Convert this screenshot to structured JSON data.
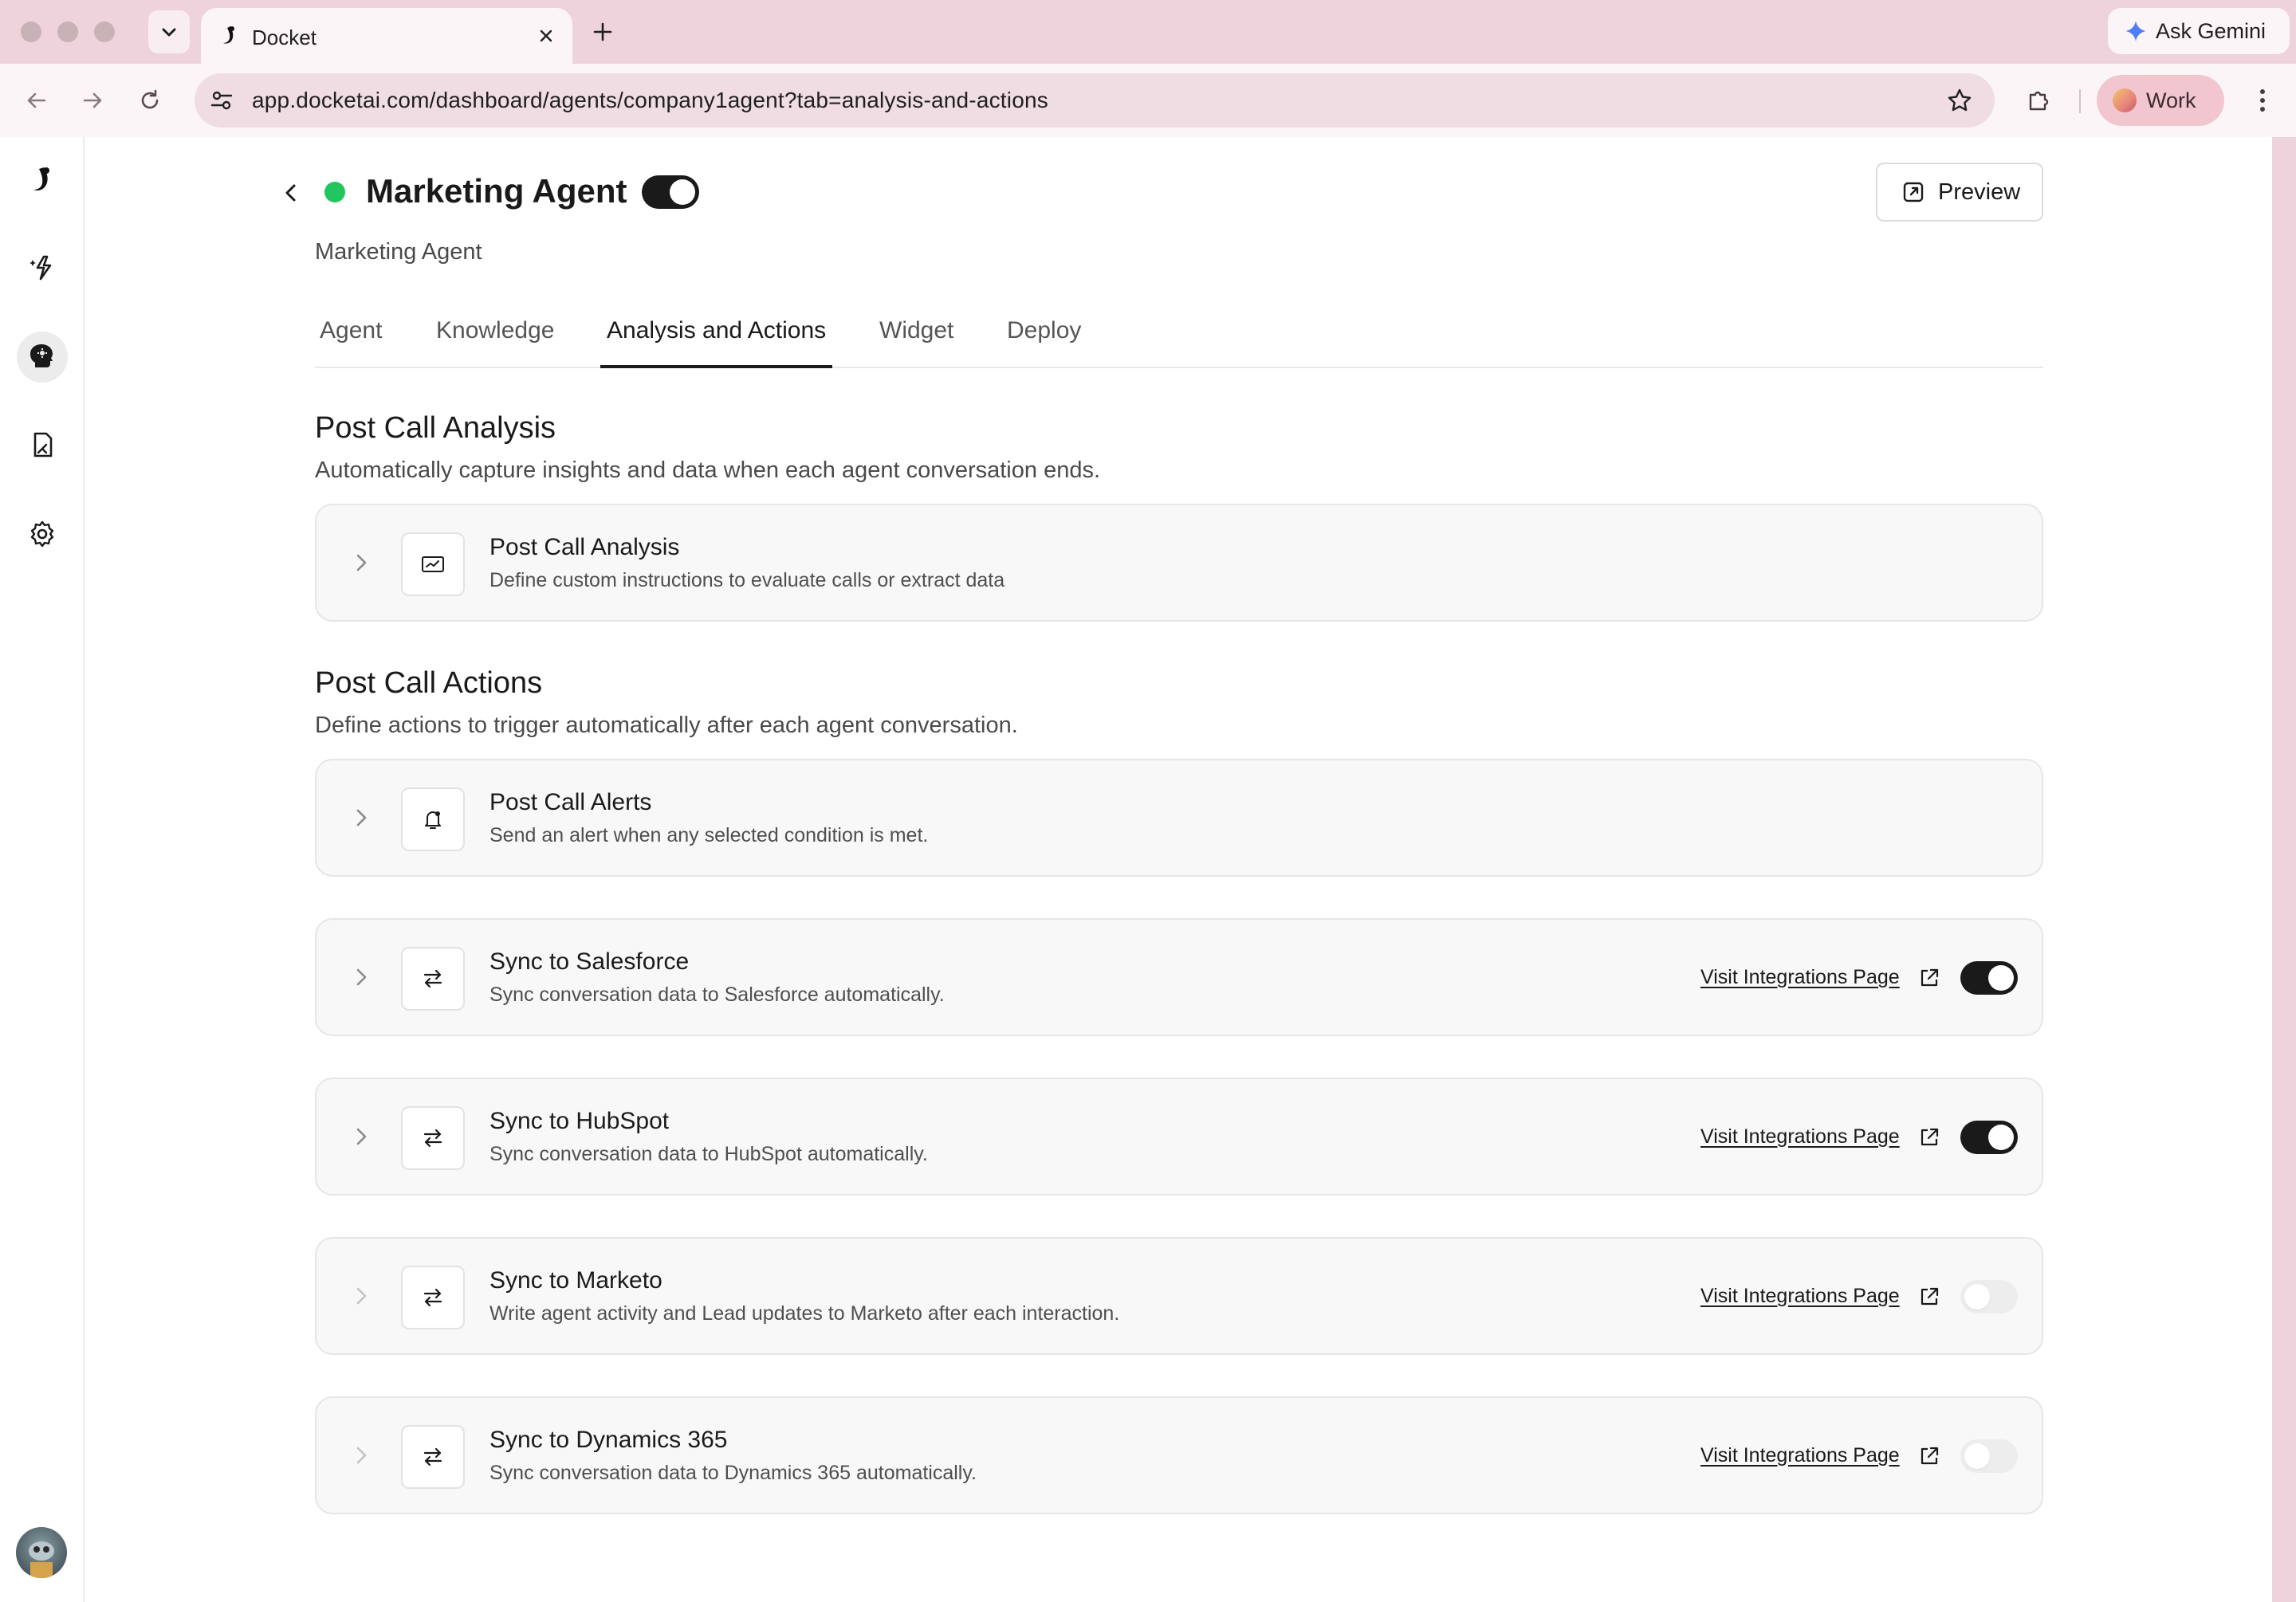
{
  "browser": {
    "tab_title": "Docket",
    "url": "app.docketai.com/dashboard/agents/company1agent?tab=analysis-and-actions",
    "gemini_label": "Ask Gemini",
    "profile_label": "Work"
  },
  "header": {
    "agent_name": "Marketing Agent",
    "agent_subtitle": "Marketing Agent",
    "agent_enabled": true,
    "status_color": "#22c55e",
    "preview_label": "Preview"
  },
  "tabs": [
    {
      "label": "Agent",
      "active": false
    },
    {
      "label": "Knowledge",
      "active": false
    },
    {
      "label": "Analysis and Actions",
      "active": true
    },
    {
      "label": "Widget",
      "active": false
    },
    {
      "label": "Deploy",
      "active": false
    }
  ],
  "analysis": {
    "title": "Post Call Analysis",
    "description": "Automatically capture insights and data when each agent conversation ends.",
    "card": {
      "title": "Post Call Analysis",
      "description": "Define custom instructions to evaluate calls or extract data",
      "icon": "analysis-card-icon"
    }
  },
  "actions": {
    "title": "Post Call Actions",
    "description": "Define actions to trigger automatically after each agent conversation.",
    "cards": [
      {
        "title": "Post Call Alerts",
        "description": "Send an alert when any selected condition is met.",
        "icon": "bell-icon"
      },
      {
        "title": "Sync to Salesforce",
        "description": "Sync conversation data to Salesforce automatically.",
        "icon": "sync-arrows-icon",
        "link": "Visit Integrations Page",
        "enabled": true
      },
      {
        "title": "Sync to HubSpot",
        "description": "Sync conversation data to HubSpot automatically.",
        "icon": "sync-arrows-icon",
        "link": "Visit Integrations Page",
        "enabled": true
      },
      {
        "title": "Sync to Marketo",
        "description": "Write agent activity and Lead updates to Marketo after each interaction.",
        "icon": "sync-arrows-icon",
        "link": "Visit Integrations Page",
        "enabled": false
      },
      {
        "title": "Sync to Dynamics 365",
        "description": "Sync conversation data to Dynamics 365 automatically.",
        "icon": "sync-arrows-icon",
        "link": "Visit Integrations Page",
        "enabled": false
      }
    ]
  }
}
